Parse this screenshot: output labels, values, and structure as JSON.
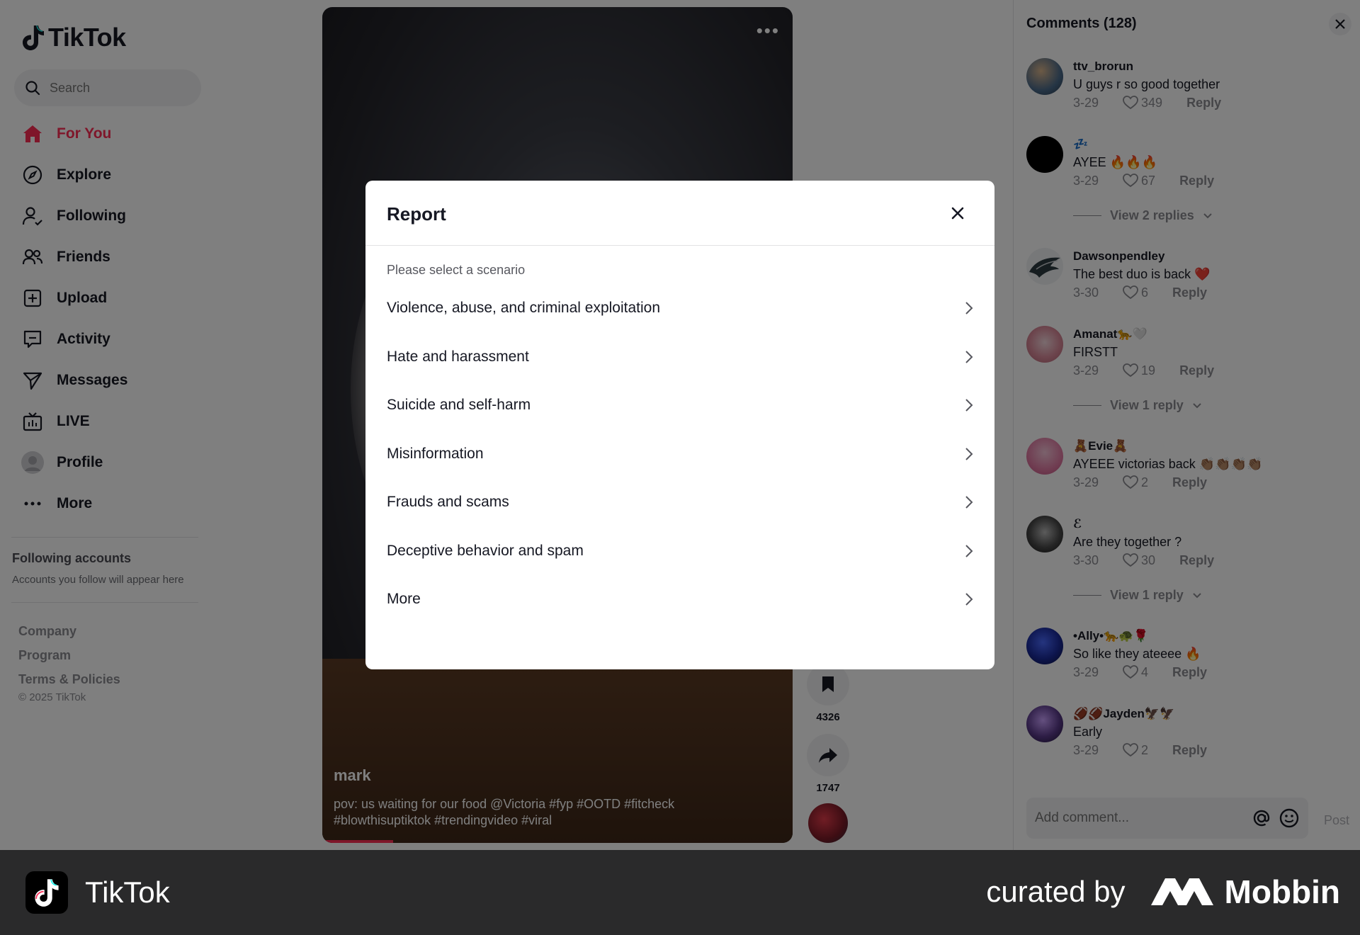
{
  "app": {
    "name": "TikTok"
  },
  "search": {
    "placeholder": "Search"
  },
  "nav": [
    {
      "label": "For You",
      "icon": "home-icon",
      "active": true
    },
    {
      "label": "Explore",
      "icon": "compass-icon"
    },
    {
      "label": "Following",
      "icon": "following-icon"
    },
    {
      "label": "Friends",
      "icon": "friends-icon"
    },
    {
      "label": "Upload",
      "icon": "upload-icon"
    },
    {
      "label": "Activity",
      "icon": "activity-icon"
    },
    {
      "label": "Messages",
      "icon": "messages-icon"
    },
    {
      "label": "LIVE",
      "icon": "live-icon"
    },
    {
      "label": "Profile",
      "icon": "profile-avatar"
    },
    {
      "label": "More",
      "icon": "more-icon"
    }
  ],
  "following_accounts": {
    "title": "Following accounts",
    "subtitle": "Accounts you follow will appear here"
  },
  "footer": {
    "links": [
      "Company",
      "Program",
      "Terms & Policies"
    ],
    "copyright": "© 2025 TikTok"
  },
  "video": {
    "author": "mark",
    "caption_line1": "pov: us waiting for our food @Victoria  #fyp  #OOTD  #fitcheck",
    "caption_line2": "#blowthisuptiktok  #trendingvideo  #viral",
    "progress": 0.15,
    "menu": "•••"
  },
  "actions": {
    "bookmarks": "4326",
    "shares": "1747"
  },
  "comments": {
    "title": "Comments (128)",
    "items": [
      {
        "user": "ttv_brorun",
        "text": "U guys r so good together",
        "date": "3-29",
        "likes": "349",
        "reply": "Reply",
        "avatar_color": "#4a6a8a"
      },
      {
        "user": "💤",
        "text": "AYEE 🔥🔥🔥",
        "date": "3-29",
        "likes": "67",
        "reply": "Reply",
        "avatar_color": "#000000",
        "view_replies": "View 2 replies"
      },
      {
        "user": "Dawsonpendley",
        "text": "The best duo is back ❤️",
        "date": "3-30",
        "likes": "6",
        "reply": "Reply",
        "avatar_color": "#c9ccd1"
      },
      {
        "user": "Amanat🐆🤍",
        "text": "FIRSTT",
        "date": "3-29",
        "likes": "19",
        "reply": "Reply",
        "avatar_color": "#d98a9a",
        "view_replies": "View 1 reply"
      },
      {
        "user": "🧸Evie🧸",
        "text": "AYEEE victorias back 👏🏽👏🏽👏🏽👏🏽",
        "date": "3-29",
        "likes": "2",
        "reply": "Reply",
        "avatar_color": "#e07aa3"
      },
      {
        "user": "ℰ",
        "text": "Are they together ?",
        "date": "3-30",
        "likes": "30",
        "reply": "Reply",
        "avatar_color": "#2a2a2a",
        "view_replies": "View 1 reply"
      },
      {
        "user": "•Ally•🐆🐢🌹",
        "text": "So like they ateeee 🔥",
        "date": "3-29",
        "likes": "4",
        "reply": "Reply",
        "avatar_color": "#1a2a9a"
      },
      {
        "user": "🏈🏈Jayden🦅🦅",
        "text": "Early",
        "date": "3-29",
        "likes": "2",
        "reply": "Reply",
        "avatar_color": "#5a3a8a"
      }
    ],
    "add_placeholder": "Add comment...",
    "post_label": "Post"
  },
  "modal": {
    "title": "Report",
    "subtitle": "Please select a scenario",
    "options": [
      "Violence, abuse, and criminal exploitation",
      "Hate and harassment",
      "Suicide and self-harm",
      "Misinformation",
      "Frauds and scams",
      "Deceptive behavior and spam",
      "More"
    ]
  },
  "brandbar": {
    "app_name": "TikTok",
    "curated_by": "curated by",
    "mobbin": "Mobbin"
  },
  "colors": {
    "accent": "#fe2c55",
    "overlay": "rgba(0,0,0,0.5)",
    "brandbar": "#2a2a2b"
  }
}
